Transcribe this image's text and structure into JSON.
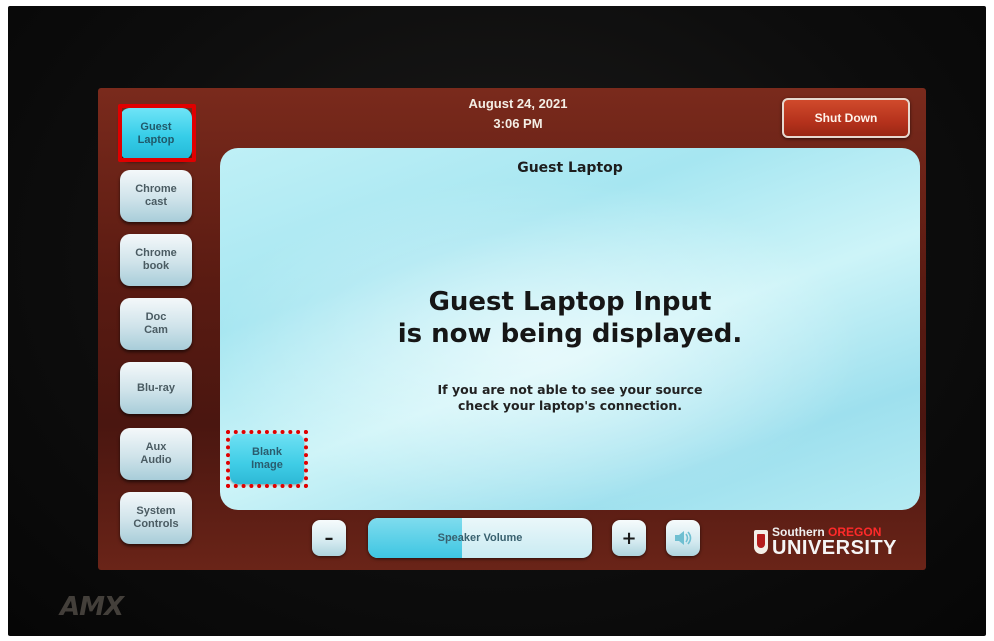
{
  "header": {
    "date": "August 24, 2021",
    "time": "3:06 PM",
    "shutdown_label": "Shut Down"
  },
  "sources": [
    {
      "label": "Guest\nLaptop",
      "active": true
    },
    {
      "label": "Chrome\ncast",
      "active": false
    },
    {
      "label": "Chrome\nbook",
      "active": false
    },
    {
      "label": "Doc\nCam",
      "active": false
    },
    {
      "label": "Blu-ray",
      "active": false
    },
    {
      "label": "Aux\nAudio",
      "active": false
    },
    {
      "label": "System\nControls",
      "active": false
    }
  ],
  "content": {
    "title": "Guest Laptop",
    "main_message_line1": "Guest Laptop Input",
    "main_message_line2": "is now being displayed.",
    "sub_message_line1": "If you are not able to see your source",
    "sub_message_line2": "check your laptop's connection.",
    "blank_image_label": "Blank\nImage"
  },
  "volume": {
    "minus_label": "–",
    "plus_label": "+",
    "slider_label": "Speaker Volume",
    "level_fraction": 0.42,
    "mute_icon": "speaker-icon"
  },
  "branding": {
    "device_logo": "AMX",
    "university_line1_prefix": "Southern",
    "university_line1": "OREGON",
    "university_line2": "UNIVERSITY"
  },
  "colors": {
    "accent_active": "#36cde8",
    "shutdown": "#b5321c",
    "highlight": "#e00000"
  }
}
